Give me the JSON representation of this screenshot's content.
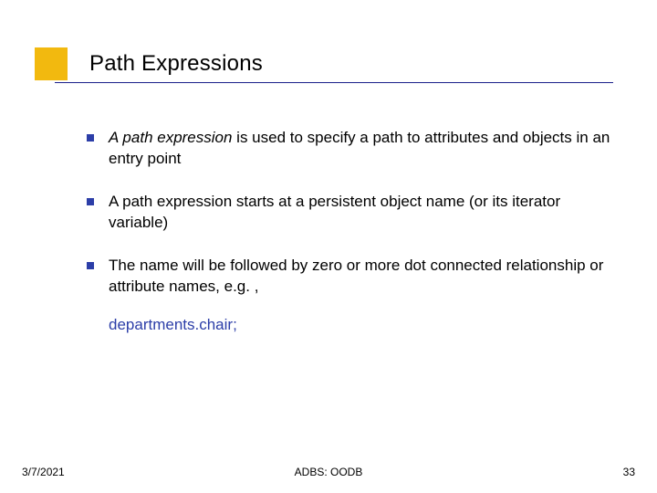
{
  "title": "Path Expressions",
  "bullets": [
    {
      "lead_italic": "A path expression",
      "rest": " is used to specify a path to attributes and objects in an entry point"
    },
    {
      "text": "A path expression starts at a persistent object name (or its iterator variable)"
    },
    {
      "text": "The name will be followed by zero or more dot connected relationship or attribute names, e.g. ,"
    }
  ],
  "example": "departments.chair;",
  "footer": {
    "date": "3/7/2021",
    "center": "ADBS: OODB",
    "page": "33"
  }
}
